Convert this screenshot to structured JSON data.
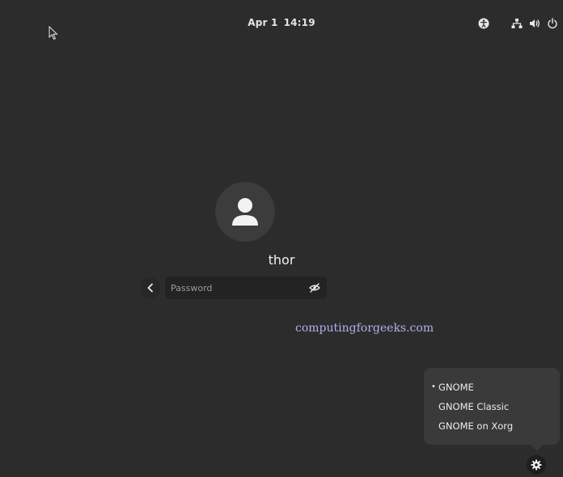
{
  "topbar": {
    "date": "Apr 1",
    "time": "14:19",
    "icons": [
      "accessibility-icon",
      "network-icon",
      "volume-icon",
      "power-icon"
    ]
  },
  "login": {
    "username": "thor",
    "password_placeholder": "Password",
    "password_value": ""
  },
  "watermark": "computingforgeeks.com",
  "session_menu": {
    "items": [
      {
        "label": "GNOME",
        "selected": true,
        "bullet": "•"
      },
      {
        "label": "GNOME Classic",
        "selected": false,
        "bullet": ""
      },
      {
        "label": "GNOME on Xorg",
        "selected": false,
        "bullet": ""
      }
    ]
  },
  "colors": {
    "background": "#2c2c2c",
    "avatar_bg": "#3c3c3c",
    "entry_bg": "#232323",
    "menu_bg": "#3a3a3a",
    "watermark": "#b0b0f0"
  }
}
